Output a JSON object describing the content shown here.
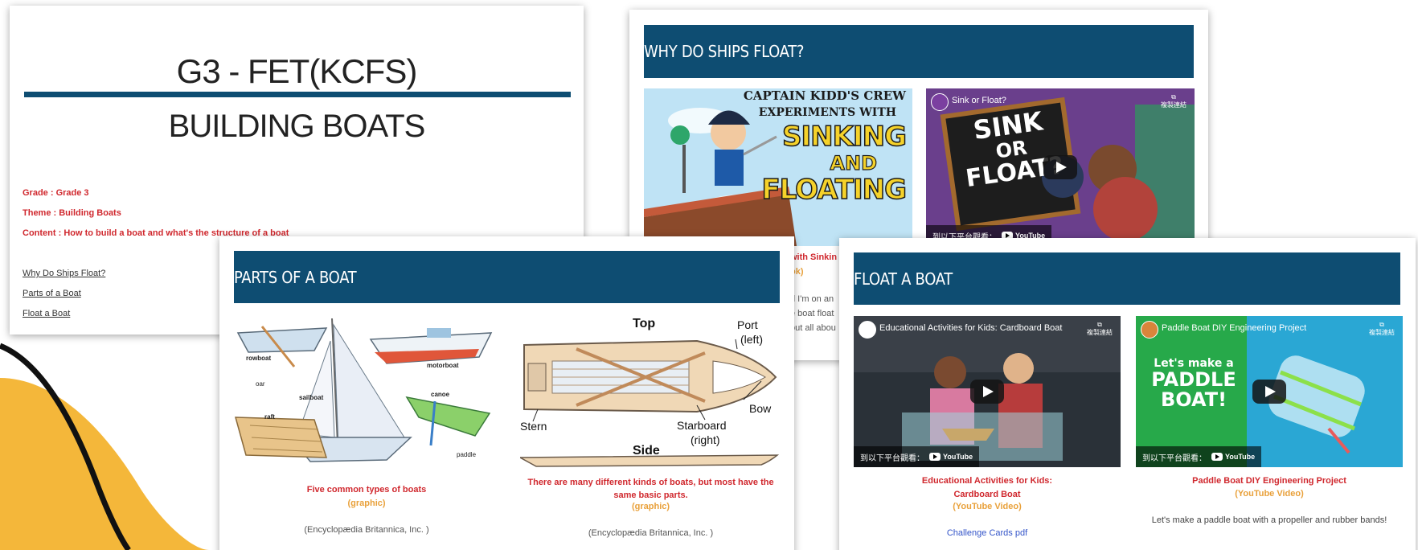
{
  "slide1": {
    "title": "G3 - FET(KCFS)",
    "subtitle": "BUILDING BOATS",
    "grade": "Grade : Grade 3",
    "theme": "Theme : Building Boats",
    "content": "Content : How to build a boat and what's the structure of a boat",
    "links": [
      "Why Do Ships Float?",
      "Parts of a Boat",
      "Float a Boat"
    ]
  },
  "slide2": {
    "heading": "WHY DO SHIPS FLOAT?",
    "book_title_lines": [
      "CAPTAIN KIDD'S CREW",
      "EXPERIMENTS WITH",
      "SINKING",
      "AND",
      "FLOATING"
    ],
    "video_title": "Sink or Float?",
    "video_art_lines": [
      "SINK",
      "OR",
      "FLOAT?"
    ],
    "copy_link": "複製連結",
    "watch_on": "到以下平台觀看：",
    "youtube": "YouTube",
    "caption_fragment_1": "with Sinkin",
    "caption_fragment_2": "ok)",
    "text_fragments": [
      "d I'm on an",
      "e boat float",
      "out all abou"
    ]
  },
  "slide3": {
    "heading": "PARTS OF A BOAT",
    "left_labels": [
      "rowboat",
      "oar",
      "motorboat",
      "sailboat",
      "canoe",
      "raft",
      "paddle"
    ],
    "right_labels": [
      "Top",
      "Port",
      "(left)",
      "Bow",
      "Stern",
      "Starboard",
      "(right)",
      "Side"
    ],
    "left_caption": "Five common types of boats",
    "left_caption_type": "(graphic)",
    "left_credit": "(Encyclopædia Britannica, Inc. )",
    "right_caption": "There are many different kinds of boats, but most have the same basic parts.",
    "right_caption_type": "(graphic)",
    "right_credit": "(Encyclopædia Britannica, Inc. )"
  },
  "slide4": {
    "heading": "FLOAT A BOAT",
    "video1": {
      "title": "Educational Activities for Kids: Cardboard Boat",
      "caption_line1": "Educational Activities for Kids:",
      "caption_line2": "Cardboard Boat",
      "type": "(YouTube Video)",
      "link": "Challenge Cards pdf"
    },
    "video2": {
      "title": "Paddle Boat DIY Engineering Project",
      "art_lines": [
        "Let's make a",
        "PADDLE",
        "BOAT!"
      ],
      "caption": "Paddle Boat DIY Engineering Project",
      "type": "(YouTube Video)",
      "desc": "Let's make a paddle boat with a propeller and rubber bands!"
    },
    "copy_link": "複製連結",
    "watch_on": "到以下平台觀看：",
    "youtube": "YouTube"
  }
}
